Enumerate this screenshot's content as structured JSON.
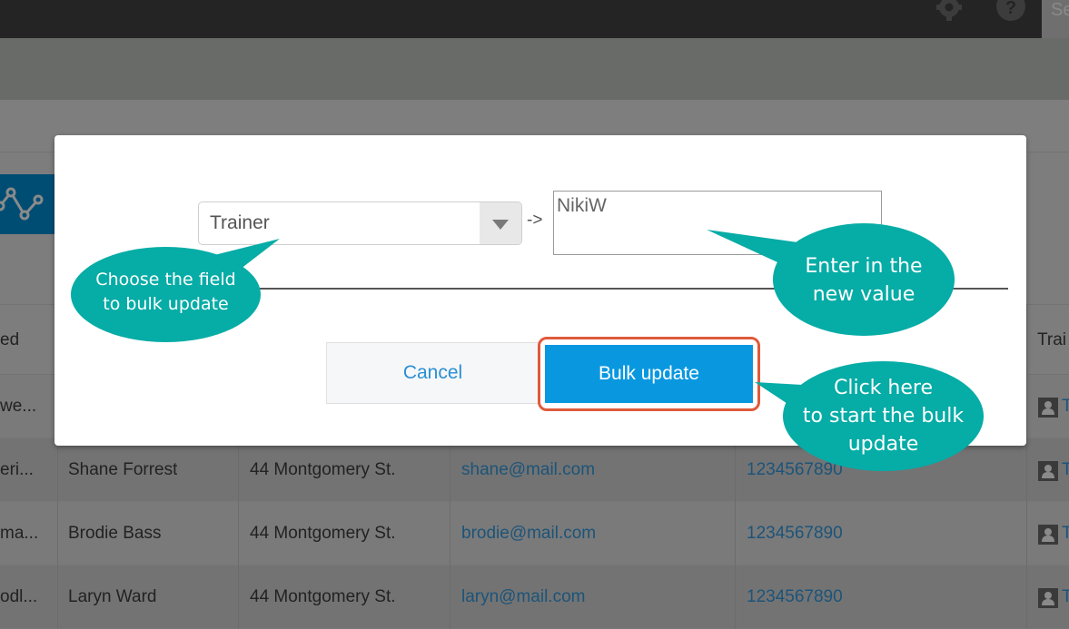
{
  "topbar": {
    "icons": [
      "gear-icon",
      "help-icon"
    ],
    "search_placeholder": "Se"
  },
  "table": {
    "headers": [
      "ed",
      "Trai"
    ],
    "rows": [
      {
        "col0": "we...",
        "name": "",
        "address": "",
        "email": "",
        "phone": "",
        "trainer": "T"
      },
      {
        "col0": "eri...",
        "name": "Shane Forrest",
        "address": "44 Montgomery St.",
        "email": "shane@mail.com",
        "phone": "1234567890",
        "trainer": "T"
      },
      {
        "col0": "ma...",
        "name": "Brodie Bass",
        "address": "44 Montgomery St.",
        "email": "brodie@mail.com",
        "phone": "1234567890",
        "trainer": "T"
      },
      {
        "col0": "odl...",
        "name": "Laryn Ward",
        "address": "44 Montgomery St.",
        "email": "laryn@mail.com",
        "phone": "1234567890",
        "trainer": "T"
      }
    ]
  },
  "modal": {
    "field_select": {
      "selected": "Trainer"
    },
    "arrow_separator": "->",
    "new_value": "NikiW",
    "cancel_label": "Cancel",
    "bulk_update_label": "Bulk update"
  },
  "callouts": {
    "choose_field": [
      "Choose the field",
      "to bulk update"
    ],
    "enter_value": [
      "Enter in the",
      "new value"
    ],
    "click_here": [
      "Click here",
      "to start the bulk",
      "update"
    ]
  },
  "colors": {
    "primary_button": "#0998e0",
    "callout": "#06aca6",
    "highlight": "#e05a3a",
    "link": "#2a8fd4"
  }
}
